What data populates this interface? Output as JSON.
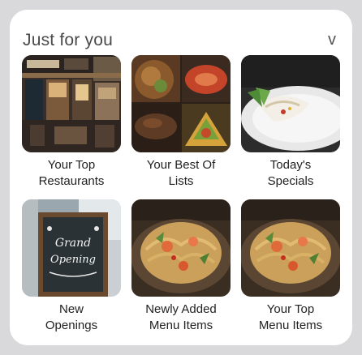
{
  "header": {
    "title": "Just for you",
    "toggle_icon": "chevron-down-icon",
    "toggle_glyph": "v"
  },
  "tiles": [
    {
      "label": "Your Top\nRestaurants",
      "image": "restaurant-storefront"
    },
    {
      "label": "Your Best Of\nLists",
      "image": "food-collage"
    },
    {
      "label": "Today's\nSpecials",
      "image": "plated-dish"
    },
    {
      "label": "New\nOpenings",
      "image": "grand-opening-chalkboard"
    },
    {
      "label": "Newly Added\nMenu Items",
      "image": "pasta-plate"
    },
    {
      "label": "Your Top\nMenu Items",
      "image": "pasta-plate"
    }
  ]
}
